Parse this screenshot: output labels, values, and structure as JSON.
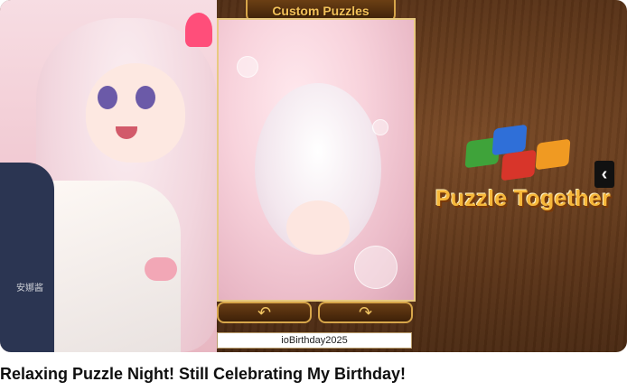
{
  "thumbnail": {
    "banner_label": "Custom Puzzles",
    "puzzle_name": "ioBirthday2025",
    "logo_text": "Puzzle Together",
    "watermark": "安娜酱",
    "rotate_left_icon": "rotate-left-icon",
    "rotate_right_icon": "rotate-right-icon",
    "chevron_icon": "chevron-left-icon",
    "colors": {
      "accent_gold": "#d7a64a",
      "logo_orange": "#f6b73a",
      "wood_dark": "#3a200d"
    }
  },
  "video": {
    "title": "Relaxing Puzzle Night! Still Celebrating My Birthday!"
  }
}
